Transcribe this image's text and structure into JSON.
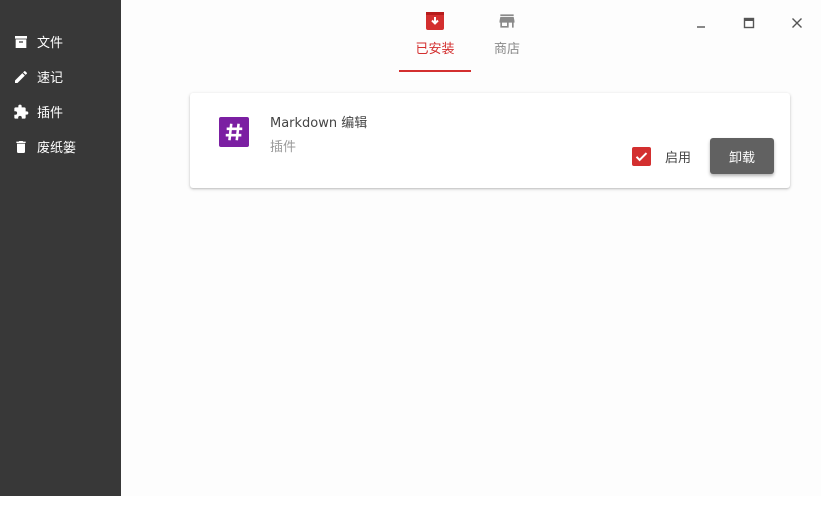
{
  "sidebar": {
    "items": [
      {
        "label": "文件",
        "icon": "archive-icon"
      },
      {
        "label": "速记",
        "icon": "pencil-icon"
      },
      {
        "label": "插件",
        "icon": "puzzle-icon"
      },
      {
        "label": "废纸篓",
        "icon": "trash-icon"
      }
    ]
  },
  "tabs": [
    {
      "label": "已安装",
      "icon": "download-box-icon",
      "active": true
    },
    {
      "label": "商店",
      "icon": "store-icon",
      "active": false
    }
  ],
  "window_controls": {
    "minimize": "minimize-icon",
    "maximize": "maximize-icon",
    "close": "close-icon"
  },
  "plugin": {
    "name": "Markdown 编辑",
    "type": "插件",
    "enabled": true,
    "enable_label": "启用",
    "uninstall_label": "卸载",
    "icon": "hash-icon",
    "icon_color": "#7b1fa2"
  },
  "colors": {
    "accent": "#d32f2f",
    "sidebar_bg": "#383838",
    "button_bg": "#616161"
  }
}
